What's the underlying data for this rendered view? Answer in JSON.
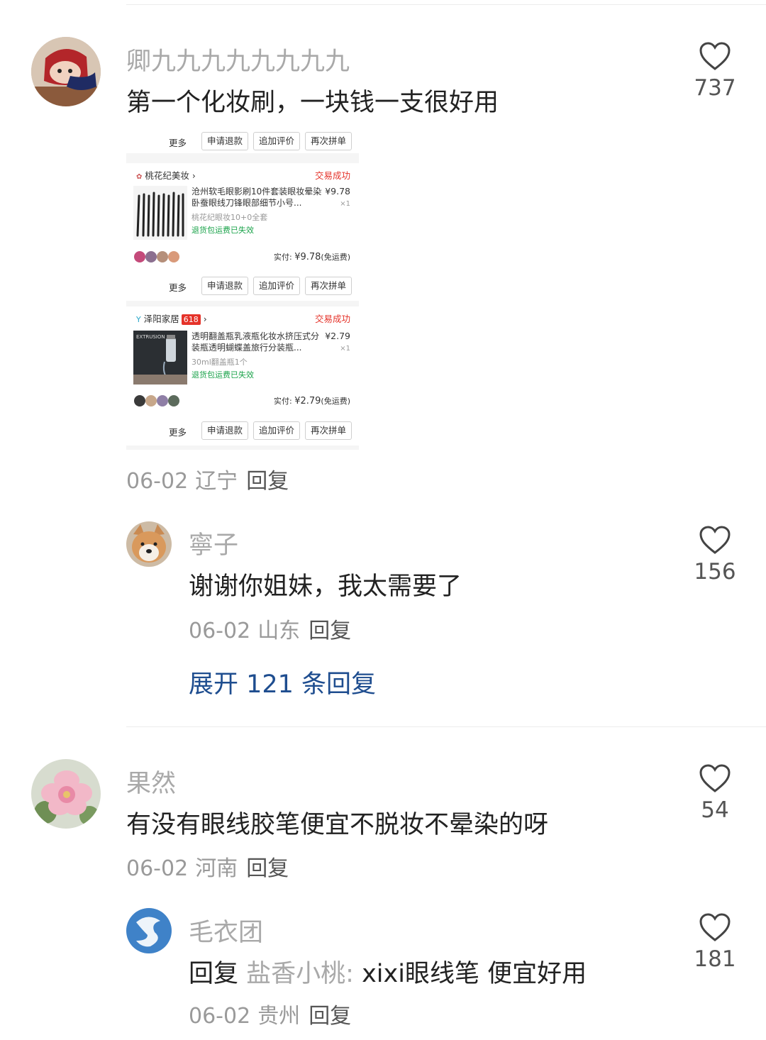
{
  "comments": [
    {
      "user": "卿九九九九九九九九",
      "text": "第一个化妆刷，一块钱一支很好用",
      "date": "06-02",
      "location": "辽宁",
      "reply_label": "回复",
      "likes": "737",
      "attachment": {
        "top_buttons": {
          "more": "更多",
          "b1": "申请退款",
          "b2": "追加评价",
          "b3": "再次拼单"
        },
        "orders": [
          {
            "store": "桃花纪美妆",
            "status": "交易成功",
            "title": "沧州软毛眼影刷10件套装眼妆晕染卧蚕眼线刀锋眼部细节小号...",
            "price": "¥9.78",
            "qty": "×1",
            "spec": "桃花纪眼妆10+0全套",
            "returns": "退货包运费已失效",
            "paid_label": "实付:",
            "paid_value": "¥9.78",
            "shipping": "(免运费)",
            "buttons": {
              "more": "更多",
              "b1": "申请退款",
              "b2": "追加评价",
              "b3": "再次拼单"
            }
          },
          {
            "store": "泽阳家居",
            "tag": "618",
            "status": "交易成功",
            "title": "透明翻盖瓶乳液瓶化妆水挤压式分装瓶透明蝴蝶盖旅行分装瓶...",
            "price": "¥2.79",
            "qty": "×1",
            "spec": "30ml翻盖瓶1个",
            "returns": "退货包运费已失效",
            "paid_label": "实付:",
            "paid_value": "¥2.79",
            "shipping": "(免运费)",
            "thumb_text": "EXTRUSION",
            "buttons": {
              "more": "更多",
              "b1": "申请退款",
              "b2": "追加评价",
              "b3": "再次拼单"
            }
          }
        ]
      },
      "replies": [
        {
          "user": "寧子",
          "text": "谢谢你姐妹，我太需要了",
          "date": "06-02",
          "location": "山东",
          "reply_label": "回复",
          "likes": "156"
        }
      ],
      "expand_label": "展开 121 条回复"
    },
    {
      "user": "果然",
      "text": "有没有眼线胶笔便宜不脱妆不晕染的呀",
      "date": "06-02",
      "location": "河南",
      "reply_label": "回复",
      "likes": "54",
      "replies": [
        {
          "user": "毛衣团",
          "reply_prefix": "回复",
          "reply_to": "盐香小桃:",
          "text": " xixi眼线笔  便宜好用",
          "date": "06-02",
          "location": "贵州",
          "reply_label": "回复",
          "likes": "181"
        }
      ]
    }
  ],
  "colors": {
    "link": "#1e4d8f",
    "name": "#a9a9a9",
    "success": "#e5332a",
    "green": "#1aa34a"
  },
  "icons": {
    "like": "heart-outline-icon"
  }
}
